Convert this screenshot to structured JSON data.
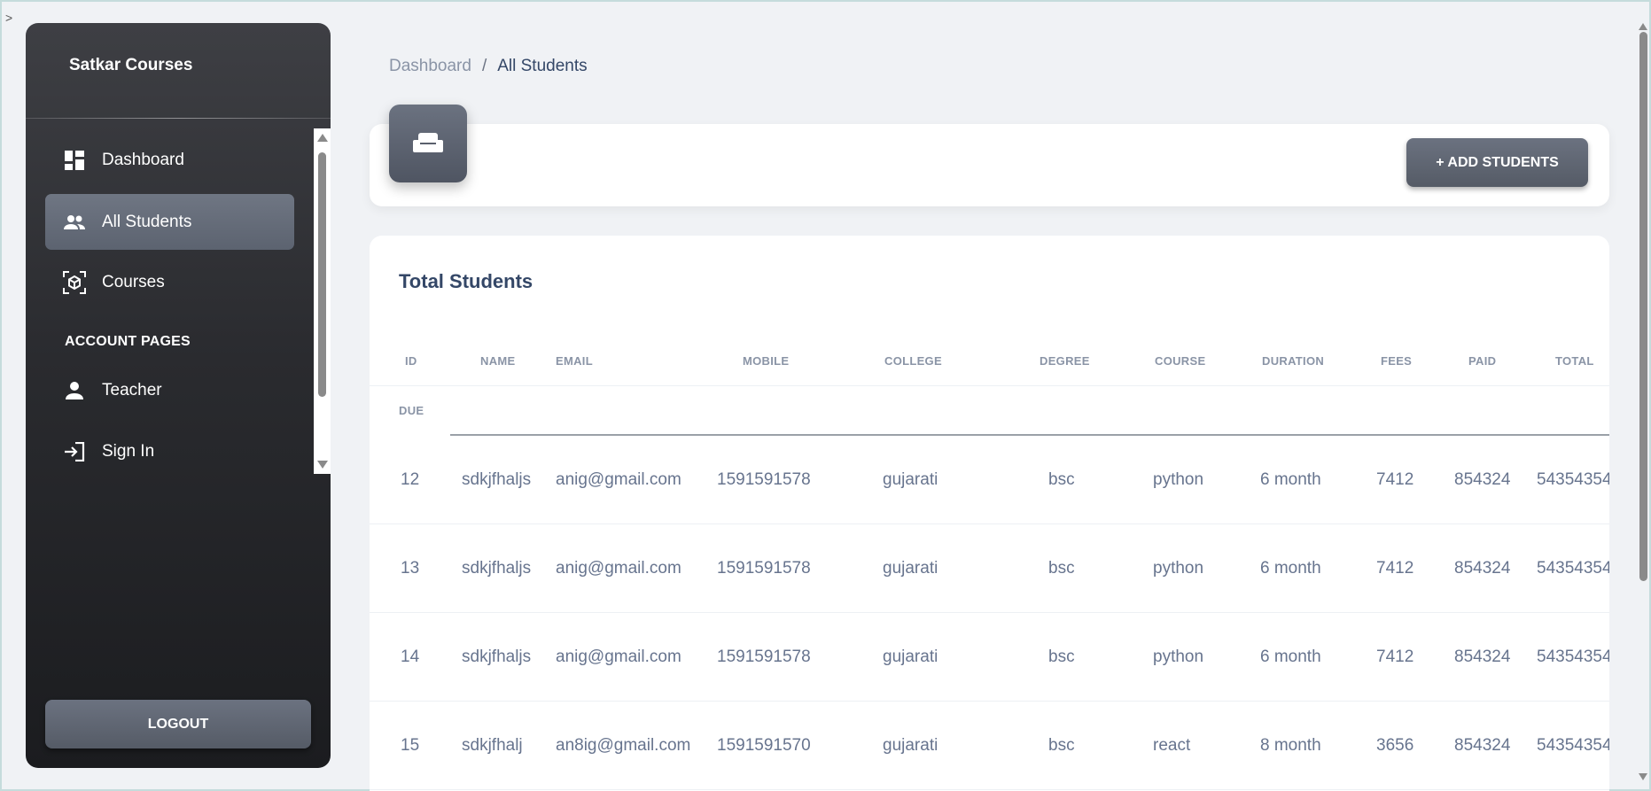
{
  "corner_mark": ">",
  "sidebar": {
    "brand": "Satkar Courses",
    "items": [
      {
        "label": "Dashboard",
        "icon": "dashboard-icon"
      },
      {
        "label": "All Students",
        "icon": "people-icon",
        "active": true
      },
      {
        "label": "Courses",
        "icon": "cube-icon"
      }
    ],
    "section_title": "ACCOUNT PAGES",
    "account_items": [
      {
        "label": "Teacher",
        "icon": "person-icon"
      },
      {
        "label": "Sign In",
        "icon": "login-icon"
      }
    ],
    "logout_label": "LOGOUT"
  },
  "breadcrumb": {
    "parent": "Dashboard",
    "separator": "/",
    "current": "All Students"
  },
  "header": {
    "icon": "couch-icon",
    "add_button_label": "+ ADD STUDENTS"
  },
  "table": {
    "title": "Total Students",
    "columns": [
      "ID",
      "NAME",
      "EMAIL",
      "MOBILE",
      "COLLEGE",
      "DEGREE",
      "COURSE",
      "DURATION",
      "FEES",
      "PAID",
      "TOTAL",
      "DUE"
    ],
    "rows": [
      {
        "id": "12",
        "name": "sdkjfhaljs",
        "email": "anig@gmail.com",
        "mobile": "1591591578",
        "college": "gujarati",
        "degree": "bsc",
        "course": "python",
        "duration": "6 month",
        "fees": "7412",
        "paid": "854324",
        "total": "54354354"
      },
      {
        "id": "13",
        "name": "sdkjfhaljs",
        "email": "anig@gmail.com",
        "mobile": "1591591578",
        "college": "gujarati",
        "degree": "bsc",
        "course": "python",
        "duration": "6 month",
        "fees": "7412",
        "paid": "854324",
        "total": "54354354"
      },
      {
        "id": "14",
        "name": "sdkjfhaljs",
        "email": "anig@gmail.com",
        "mobile": "1591591578",
        "college": "gujarati",
        "degree": "bsc",
        "course": "python",
        "duration": "6 month",
        "fees": "7412",
        "paid": "854324",
        "total": "54354354"
      },
      {
        "id": "15",
        "name": "sdkjfhalj",
        "email": "an8ig@gmail.com",
        "mobile": "1591591570",
        "college": "gujarati",
        "degree": "bsc",
        "course": "react",
        "duration": "8 month",
        "fees": "3656",
        "paid": "854324",
        "total": "54354354"
      }
    ]
  },
  "colors": {
    "sidebar_bg": "#2a2b2f",
    "active_item": "#6f7683",
    "button": "#5f6673",
    "title": "#344767",
    "body_text": "#67748e"
  }
}
